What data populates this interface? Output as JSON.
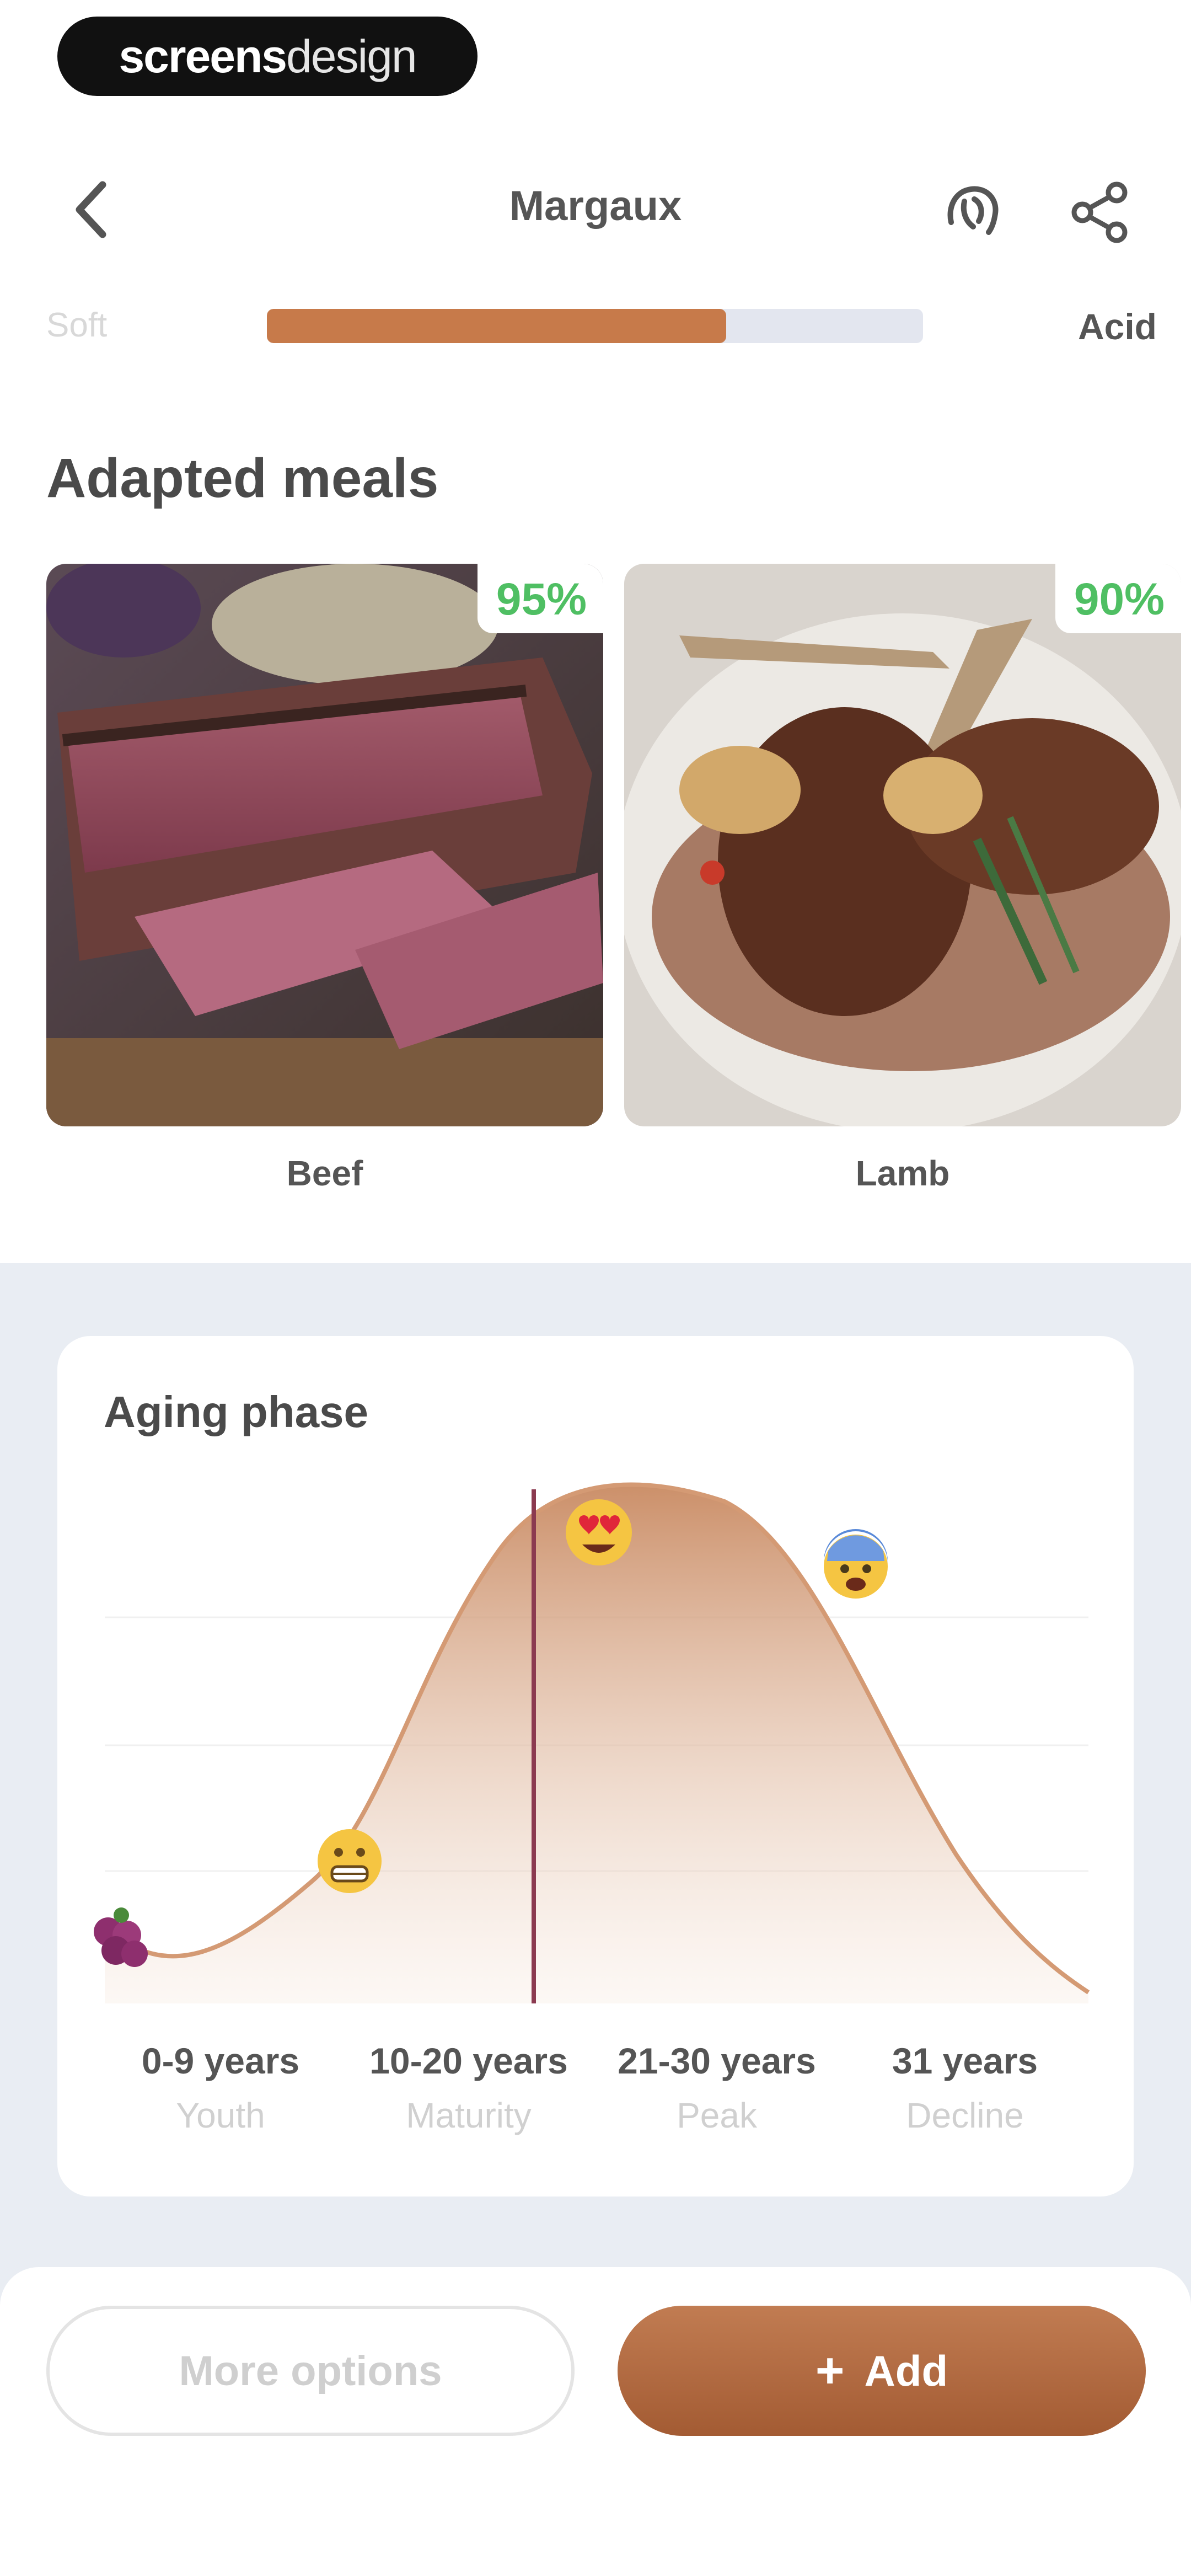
{
  "watermark": {
    "bold": "screens",
    "light": "design"
  },
  "header": {
    "title": "Margaux",
    "back_icon": "chevron-left-icon",
    "gesture_icon": "hand-icon",
    "share_icon": "share-icon"
  },
  "taste_slider": {
    "left_label": "Soft",
    "right_label": "Acid",
    "value": 0.7,
    "fill_color": "#c77a4a",
    "track_color": "#e3e6ef"
  },
  "meals": {
    "title": "Adapted meals",
    "items": [
      {
        "label": "Beef",
        "match": "95%"
      },
      {
        "label": "Lamb",
        "match": "90%"
      }
    ]
  },
  "aging": {
    "title": "Aging phase",
    "current_marker_color": "#8b3a50",
    "curve_color": "#d49a74",
    "ticks": [
      "0-9 years",
      "10-20 years",
      "21-30 years",
      "31 years"
    ],
    "phases": [
      "Youth",
      "Maturity",
      "Peak",
      "Decline"
    ],
    "emojis": [
      "grapes-icon",
      "grimace-emoji-icon",
      "heart-eyes-emoji-icon",
      "anxious-emoji-icon"
    ]
  },
  "actions": {
    "more_label": "More options",
    "add_label": "Add",
    "add_icon": "plus-icon",
    "accent": "#b0683d"
  }
}
